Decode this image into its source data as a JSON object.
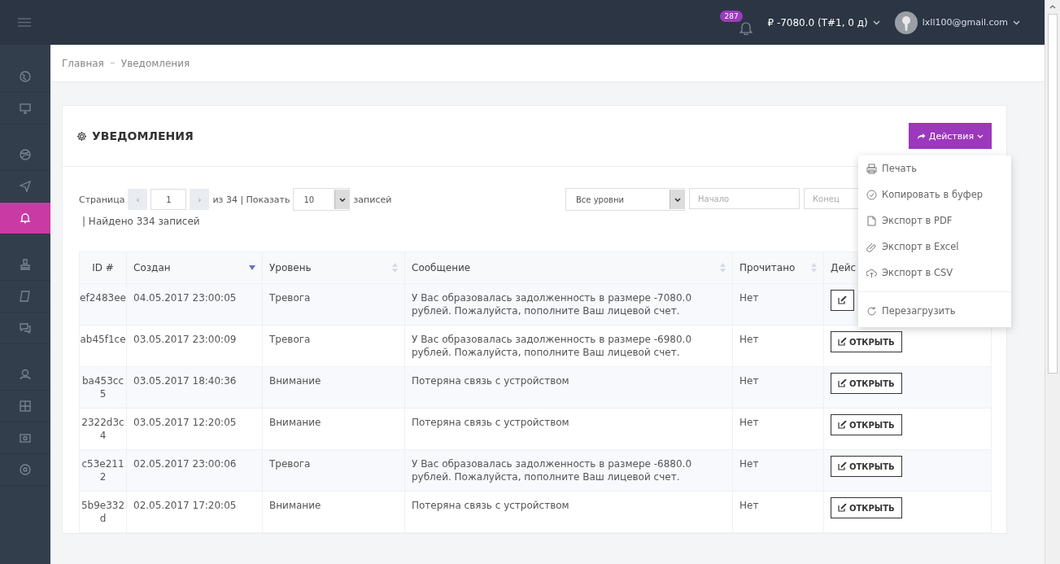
{
  "topbar": {
    "notifications_badge": "287",
    "balance": "₽ -7080.0 (Т#1, 0 д)",
    "user_email": "lxll100@gmail.com"
  },
  "sidebar": {
    "items": [
      {
        "selected": false
      },
      {
        "selected": false
      },
      {
        "selected": false
      },
      {
        "selected": false
      },
      {
        "selected": true
      },
      {
        "selected": false
      },
      {
        "selected": false
      },
      {
        "selected": false
      },
      {
        "selected": false
      },
      {
        "selected": false
      },
      {
        "selected": false
      },
      {
        "selected": false
      }
    ]
  },
  "breadcrumb": [
    "Главная",
    "Уведомления"
  ],
  "card": {
    "title": "УВЕДОМЛЕНИЯ",
    "actions_button": "Действия",
    "actions_menu": [
      {
        "label": "Печать",
        "divider_before": false
      },
      {
        "label": "Копировать в буфер",
        "divider_before": false
      },
      {
        "label": "Экспорт в PDF",
        "divider_before": false
      },
      {
        "label": "Экспорт в Excel",
        "divider_before": false
      },
      {
        "label": "Экспорт в CSV",
        "divider_before": false
      },
      {
        "label": "Перезагрузить",
        "divider_before": true
      }
    ]
  },
  "pagination": {
    "page_label": "Страница",
    "prev": "‹",
    "page": "1",
    "next": "›",
    "of_text": "из 34 | Показать",
    "per_page": "10",
    "records_label": "записей",
    "found_text": "| Найдено 334 записей"
  },
  "filters": {
    "level": "Все уровни",
    "start_placeholder": "Начало",
    "end_placeholder": "Конец"
  },
  "table": {
    "columns": [
      {
        "label": "ID #",
        "sortable": false,
        "sorted": false
      },
      {
        "label": "Создан",
        "sortable": true,
        "sorted": true
      },
      {
        "label": "Уровень",
        "sortable": true,
        "sorted": false
      },
      {
        "label": "Сообщение",
        "sortable": true,
        "sorted": false
      },
      {
        "label": "Прочитано",
        "sortable": true,
        "sorted": false
      },
      {
        "label": "Дейс",
        "sortable": false,
        "sorted": false
      }
    ],
    "rows": [
      {
        "id": "ef2483ee",
        "created": "04.05.2017 23:00:05",
        "level": "Тревога",
        "message": "У Вас образовалась задолженность в размере -7080.0 рублей. Пожалуйста, пополните Ваш лицевой счет.",
        "read": "Нет"
      },
      {
        "id": "ab45f1ce",
        "created": "03.05.2017 23:00:09",
        "level": "Тревога",
        "message": "У Вас образовалась задолженность в размере -6980.0 рублей. Пожалуйста, пополните Ваш лицевой счет.",
        "read": "Нет",
        "action": "ОТКРЫТЬ"
      },
      {
        "id": "ba453cc5",
        "created": "03.05.2017 18:40:36",
        "level": "Внимание",
        "message": "Потеряна связь с устройством",
        "read": "Нет",
        "action": "ОТКРЫТЬ"
      },
      {
        "id": "2322d3c4",
        "created": "03.05.2017 12:20:05",
        "level": "Внимание",
        "message": "Потеряна связь с устройством",
        "read": "Нет",
        "action": "ОТКРЫТЬ"
      },
      {
        "id": "c53e2112",
        "created": "02.05.2017 23:00:06",
        "level": "Тревога",
        "message": "У Вас образовалась задолженность в размере -6880.0 рублей. Пожалуйста, пополните Ваш лицевой счет.",
        "read": "Нет",
        "action": "ОТКРЫТЬ"
      },
      {
        "id": "5b9e332d",
        "created": "02.05.2017 17:20:05",
        "level": "Внимание",
        "message": "Потеряна связь с устройством",
        "read": "Нет",
        "action": "ОТКРЫТЬ"
      }
    ]
  }
}
